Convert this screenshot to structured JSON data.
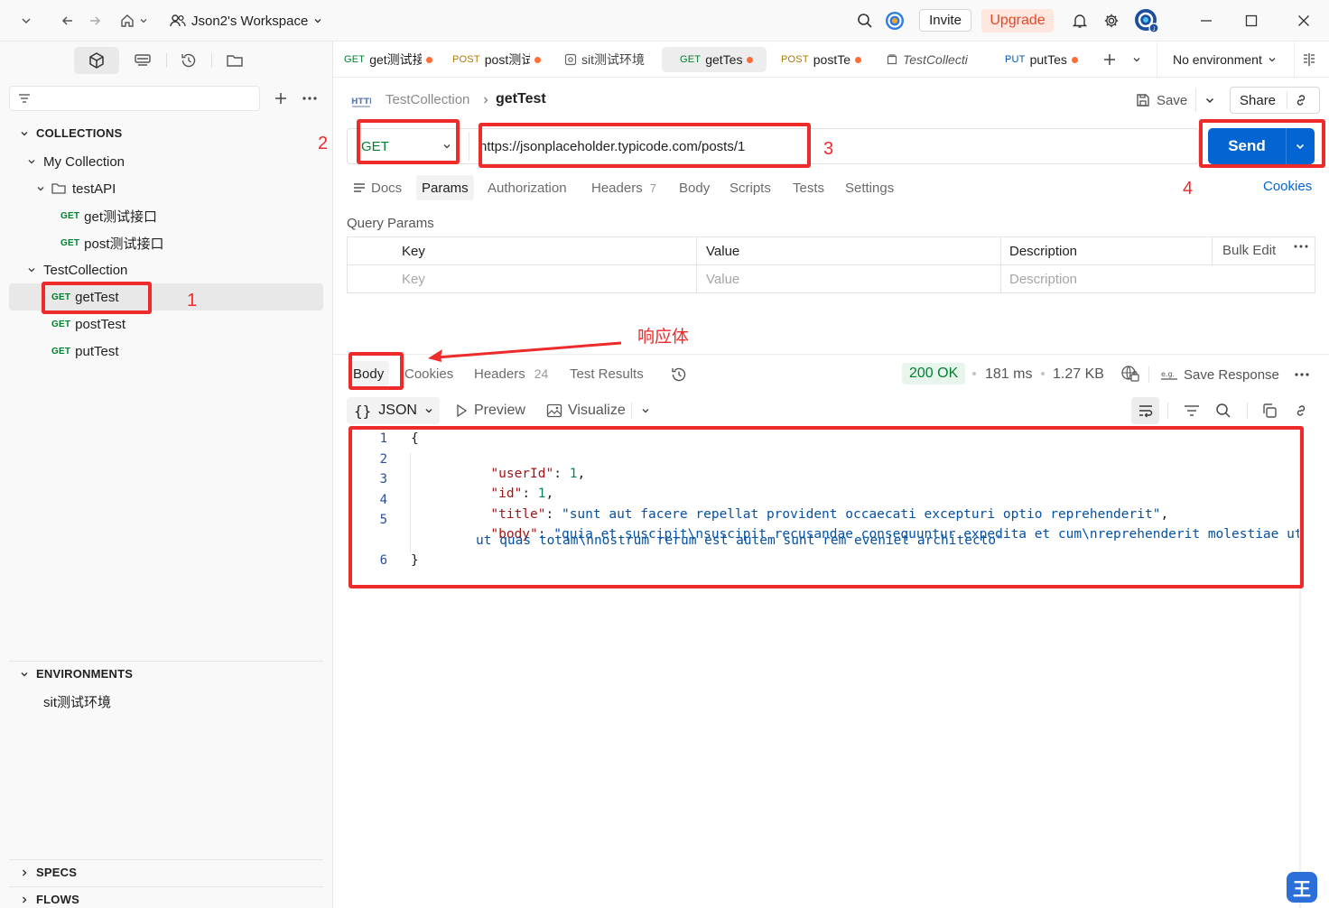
{
  "titlebar": {
    "workspace": "Json2's Workspace",
    "invite": "Invite",
    "upgrade": "Upgrade"
  },
  "tabs": [
    {
      "method": "GET",
      "label": "get测试接",
      "dot": true,
      "active": false
    },
    {
      "method": "POST",
      "label": "post测试",
      "dot": true,
      "active": false
    },
    {
      "method": "",
      "label": "sit测试环境",
      "dot": false,
      "active": false
    },
    {
      "method": "GET",
      "label": "getTes",
      "dot": true,
      "active": true
    },
    {
      "method": "POST",
      "label": "postTe",
      "dot": true,
      "active": false
    },
    {
      "method": "",
      "label": "TestCollecti",
      "dot": false,
      "active": false
    },
    {
      "method": "PUT",
      "label": "putTes",
      "dot": true,
      "active": false
    }
  ],
  "environment": "No environment",
  "sidebar": {
    "collections_header": "COLLECTIONS",
    "my_collection": "My Collection",
    "folder": "testAPI",
    "folder_items": [
      {
        "method": "GET",
        "label": "get测试接口"
      },
      {
        "method": "GET",
        "label": "post测试接口"
      }
    ],
    "test_collection": "TestCollection",
    "collection_items": [
      {
        "method": "GET",
        "label": "getTest"
      },
      {
        "method": "GET",
        "label": "postTest"
      },
      {
        "method": "GET",
        "label": "putTest"
      }
    ],
    "environments_header": "ENVIRONMENTS",
    "environment_item": "sit测试环境",
    "specs_header": "SPECS",
    "flows_header": "FLOWS"
  },
  "request": {
    "breadcrumb_parent": "TestCollection",
    "breadcrumb_current": "getTest",
    "save": "Save",
    "share": "Share",
    "method": "GET",
    "url": "https://jsonplaceholder.typicode.com/posts/1",
    "send": "Send",
    "tabs": [
      {
        "label": "Docs"
      },
      {
        "label": "Params"
      },
      {
        "label": "Authorization"
      },
      {
        "label": "Headers",
        "count": "7"
      },
      {
        "label": "Body"
      },
      {
        "label": "Scripts"
      },
      {
        "label": "Tests"
      },
      {
        "label": "Settings"
      }
    ],
    "cookies": "Cookies",
    "query_params_title": "Query Params",
    "table_headers": {
      "key": "Key",
      "value": "Value",
      "description": "Description",
      "bulk_edit": "Bulk Edit"
    },
    "placeholders": {
      "key": "Key",
      "value": "Value",
      "description": "Description"
    }
  },
  "response": {
    "tabs": [
      {
        "label": "Body"
      },
      {
        "label": "Cookies"
      },
      {
        "label": "Headers",
        "count": "24"
      },
      {
        "label": "Test Results"
      }
    ],
    "status": "200 OK",
    "time": "181 ms",
    "size": "1.27 KB",
    "save_response": "Save Response",
    "format": "JSON",
    "preview": "Preview",
    "visualize": "Visualize",
    "code_lines": [
      {
        "n": "1",
        "text": "{"
      },
      {
        "n": "2",
        "key": "\"userId\"",
        "value": "1",
        "type": "num"
      },
      {
        "n": "3",
        "key": "\"id\"",
        "value": "1",
        "type": "num"
      },
      {
        "n": "4",
        "key": "\"title\"",
        "value": "\"sunt aut facere repellat provident occaecati excepturi optio reprehenderit\"",
        "type": "str"
      },
      {
        "n": "5",
        "key": "\"body\"",
        "value": "\"quia et suscipit\\nsuscipit recusandae consequuntur expedita et cum\\nreprehenderit molestiae ut",
        "value_cont": "ut quas totam\\nnostrum rerum est autem sunt rem eveniet architecto\"",
        "type": "str"
      },
      {
        "n": "6",
        "text": "}"
      }
    ]
  },
  "annotations": {
    "n1": "1",
    "n2": "2",
    "n3": "3",
    "n4": "4",
    "response_body_label": "响应体"
  },
  "colors": {
    "accent_orange": "#ff6c37",
    "send_blue": "#0265d2",
    "annotation_red": "#ee2b2b",
    "status_green": "#007f31"
  }
}
